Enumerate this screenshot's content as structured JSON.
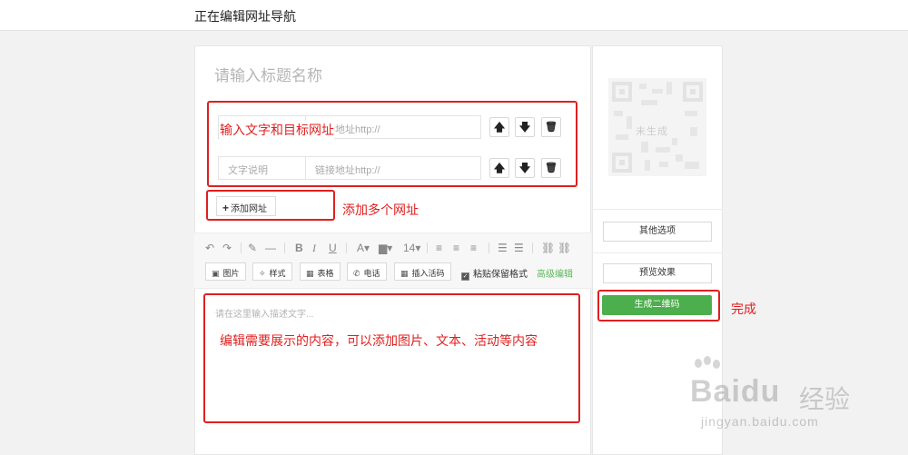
{
  "header": {
    "title": "正在编辑网址导航"
  },
  "editor": {
    "title_placeholder": "请输入标题名称",
    "links": [
      {
        "text_placeholder": "文字说明",
        "url_placeholder": "链接地址http://"
      },
      {
        "text_placeholder": "文字说明",
        "url_placeholder": "链接地址http://"
      }
    ],
    "row_buttons": {
      "up": "🡅",
      "down": "🡇",
      "delete": "🗑"
    },
    "add_url_label": "添加网址",
    "toolbar": {
      "font_size": "14",
      "buttons": {
        "image": "图片",
        "style": "样式",
        "table": "表格",
        "phone": "电话",
        "activity_code": "插入活码"
      },
      "keep_format_label": "粘贴保留格式",
      "advanced_label": "高级编辑"
    },
    "description_placeholder": "请在这里输入描述文字..."
  },
  "sidebar": {
    "qr_status": "未生成",
    "other_options_label": "其他选项",
    "preview_label": "预览效果",
    "generate_label": "生成二维码"
  },
  "annotations": {
    "links_note": "输入文字和目标网址",
    "add_note": "添加多个网址",
    "content_note": "编辑需要展示的内容，可以添加图片、文本、活动等内容",
    "done_note": "完成"
  },
  "watermark": {
    "brand": "Baidu",
    "brand_cn": "经验",
    "url": "jingyan.baidu.com"
  },
  "colors": {
    "annotation_red": "#e01f1f",
    "generate_green": "#4cae4c",
    "advanced_green": "#5cb85c"
  }
}
